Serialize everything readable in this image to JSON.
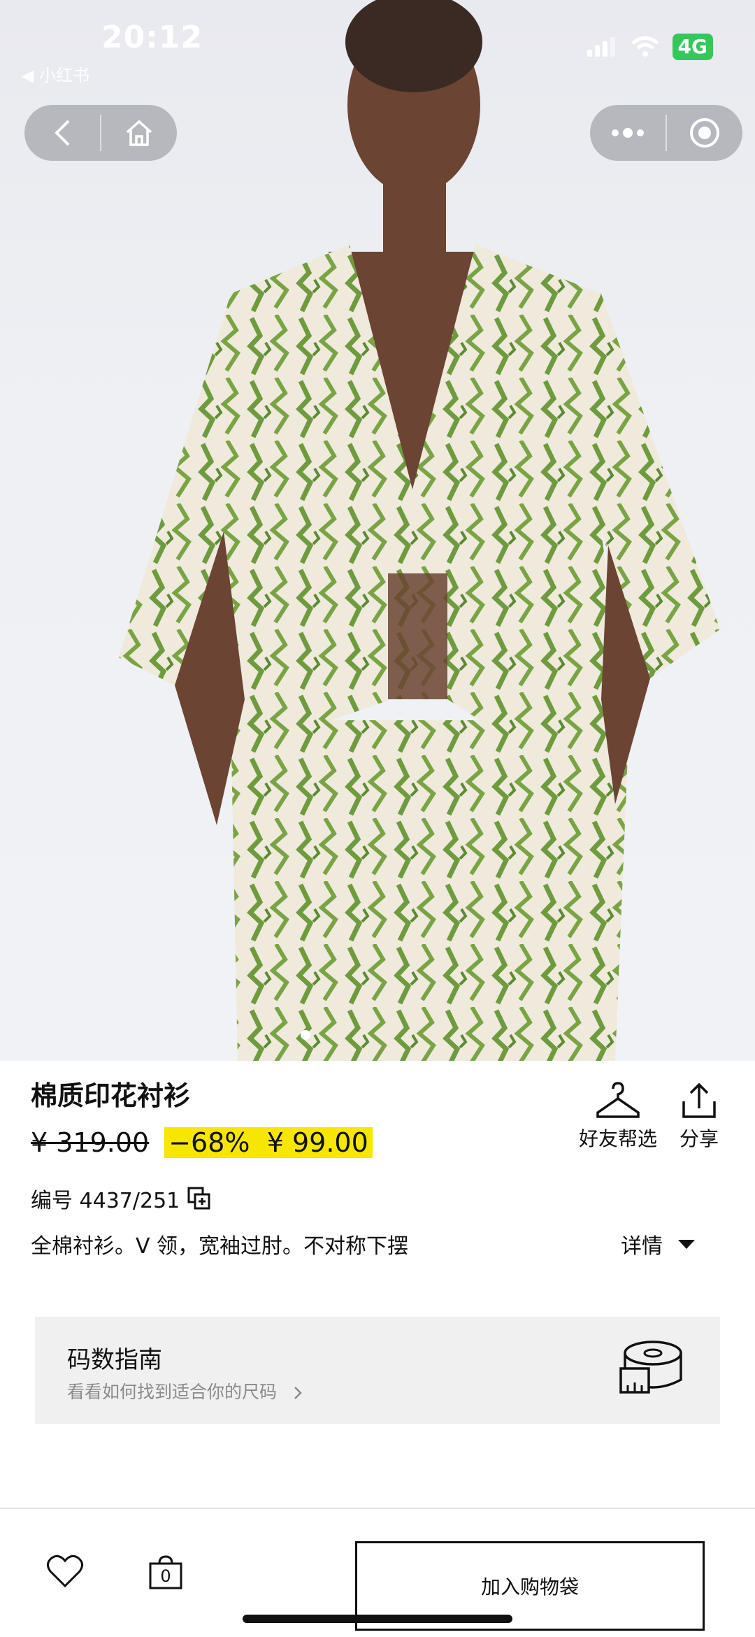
{
  "status_bar": {
    "time": "20:12",
    "back_app": "◀ 小红书",
    "network": "4G"
  },
  "product": {
    "title": "棉质印花衬衫",
    "original_price": "¥ 319.00",
    "discount": "−68%",
    "sale_price": "¥ 99.00",
    "sku": "编号 4437/251",
    "description": "全棉衬衫。V 领，宽袖过肘。不对称下摆",
    "details_label": "详情"
  },
  "actions": {
    "friend_pick": "好友帮选",
    "share": "分享"
  },
  "size_guide": {
    "title": "码数指南",
    "subtitle": "看看如何找到适合你的尺码"
  },
  "bottom_bar": {
    "bag_count": "0",
    "add_to_bag": "加入购物袋"
  },
  "colors": {
    "sale_highlight": "#f7e600",
    "print_green": "#6f9a3f",
    "print_cream": "#efeadb"
  },
  "icons": [
    "back-icon",
    "home-icon",
    "more-icon",
    "record-icon",
    "hanger-icon",
    "share-icon",
    "copy-icon",
    "chevron-right-icon",
    "tape-measure-icon",
    "heart-icon",
    "bag-icon"
  ]
}
